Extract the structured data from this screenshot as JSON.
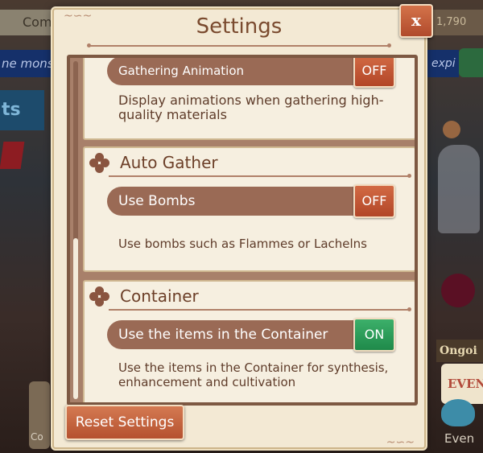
{
  "background": {
    "top_left": "Com",
    "top_right": "1,790",
    "banner_left": "ne mons",
    "banner_right": "expi",
    "sign": "ts",
    "ongoing": "Ongoi",
    "event_card": "EVEN",
    "event_label": "Even",
    "bottom_left": "Co"
  },
  "dialog": {
    "title": "Settings",
    "close_label": "x",
    "reset_label": "Reset Settings"
  },
  "sections": {
    "gathering": {
      "row_label": "Gathering Animation",
      "toggle": "OFF",
      "description": "Display animations when gathering high-quality materials"
    },
    "auto_gather": {
      "title": "Auto Gather",
      "row_label": "Use Bombs",
      "toggle": "OFF",
      "description": "Use bombs such as Flammes or Lachelns"
    },
    "container": {
      "title": "Container",
      "row_label": "Use the items in the Container",
      "toggle": "ON",
      "description": "Use the items in the Container for synthesis, enhancement and cultivation"
    }
  },
  "colors": {
    "toggle_off": "#c45a36",
    "toggle_on": "#2e9c58",
    "panel": "#f3e9d4",
    "row": "#9a6a55"
  }
}
